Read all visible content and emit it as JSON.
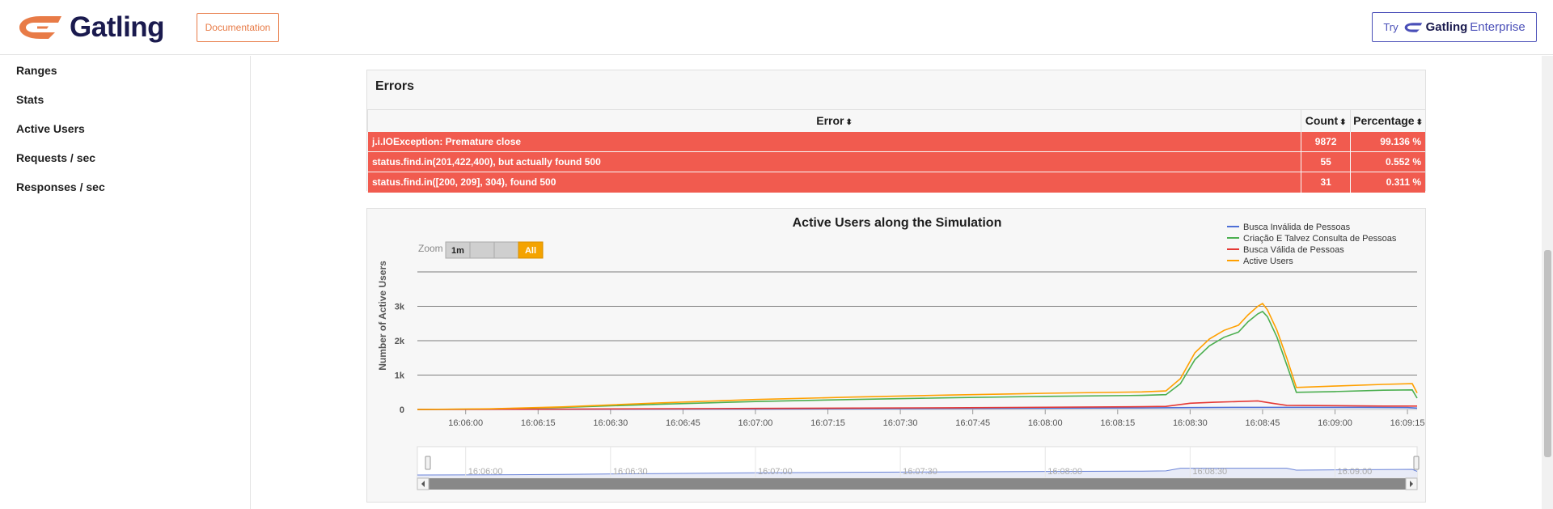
{
  "header": {
    "brand": "Gatling",
    "documentation_label": "Documentation",
    "enterprise_try": "Try",
    "enterprise_brand": "Gatling",
    "enterprise_suffix": "Enterprise"
  },
  "sidebar": {
    "items": [
      {
        "label": "Ranges"
      },
      {
        "label": "Stats"
      },
      {
        "label": "Active Users"
      },
      {
        "label": "Requests / sec"
      },
      {
        "label": "Responses / sec"
      }
    ]
  },
  "errors": {
    "title": "Errors",
    "columns": [
      "Error",
      "Count",
      "Percentage"
    ],
    "rows": [
      {
        "error": "j.i.IOException: Premature close",
        "count": "9872",
        "percentage": "99.136 %"
      },
      {
        "error": "status.find.in(201,422,400), but actually found 500",
        "count": "55",
        "percentage": "0.552 %"
      },
      {
        "error": "status.find.in([200, 209], 304), found 500",
        "count": "31",
        "percentage": "0.311 %"
      }
    ],
    "row_color": "#f15b4f"
  },
  "chart_data": {
    "type": "line",
    "title": "Active Users along the Simulation",
    "ylabel": "Number of Active Users",
    "xlabel": "",
    "zoom": {
      "label": "Zoom",
      "buttons": [
        "1m",
        "",
        "",
        "All"
      ],
      "active": "All"
    },
    "x_ticks": [
      "16:06:00",
      "16:06:15",
      "16:06:30",
      "16:06:45",
      "16:07:00",
      "16:07:15",
      "16:07:30",
      "16:07:45",
      "16:08:00",
      "16:08:15",
      "16:08:30",
      "16:08:45",
      "16:09:00",
      "16:09:15"
    ],
    "y_ticks": [
      "0",
      "1k",
      "2k",
      "3k"
    ],
    "ylim": [
      0,
      4000
    ],
    "x_range_seconds": [
      -10,
      197
    ],
    "navigator_ticks": [
      "16:06:00",
      "16:06:30",
      "16:07:00",
      "16:07:30",
      "16:08:00",
      "16:08:30",
      "16:09:00"
    ],
    "legend_position": "top-right",
    "series": [
      {
        "name": "Busca Inválida de Pessoas",
        "color": "#4e6fd6",
        "points": [
          [
            -10,
            0
          ],
          [
            20,
            5
          ],
          [
            60,
            15
          ],
          [
            100,
            30
          ],
          [
            140,
            45
          ],
          [
            150,
            55
          ],
          [
            160,
            60
          ],
          [
            170,
            60
          ],
          [
            185,
            60
          ],
          [
            195,
            55
          ],
          [
            197,
            40
          ]
        ]
      },
      {
        "name": "Criação E Talvez Consulta de Pessoas",
        "color": "#4caf50",
        "points": [
          [
            -10,
            0
          ],
          [
            5,
            15
          ],
          [
            20,
            60
          ],
          [
            40,
            150
          ],
          [
            60,
            230
          ],
          [
            80,
            290
          ],
          [
            100,
            340
          ],
          [
            120,
            380
          ],
          [
            140,
            410
          ],
          [
            145,
            430
          ],
          [
            148,
            750
          ],
          [
            151,
            1450
          ],
          [
            154,
            1850
          ],
          [
            157,
            2100
          ],
          [
            160,
            2250
          ],
          [
            162,
            2550
          ],
          [
            164,
            2780
          ],
          [
            165,
            2850
          ],
          [
            166,
            2700
          ],
          [
            168,
            2100
          ],
          [
            170,
            1300
          ],
          [
            172,
            500
          ],
          [
            180,
            520
          ],
          [
            190,
            560
          ],
          [
            196,
            570
          ],
          [
            197,
            330
          ]
        ]
      },
      {
        "name": "Busca Válida de Pessoas",
        "color": "#e53935",
        "points": [
          [
            -10,
            0
          ],
          [
            20,
            10
          ],
          [
            60,
            30
          ],
          [
            100,
            50
          ],
          [
            140,
            80
          ],
          [
            145,
            90
          ],
          [
            150,
            180
          ],
          [
            155,
            210
          ],
          [
            160,
            230
          ],
          [
            164,
            250
          ],
          [
            167,
            180
          ],
          [
            170,
            120
          ],
          [
            180,
            110
          ],
          [
            190,
            100
          ],
          [
            197,
            100
          ]
        ]
      },
      {
        "name": "Active Users",
        "color": "#ffa000",
        "points": [
          [
            -10,
            0
          ],
          [
            5,
            20
          ],
          [
            20,
            75
          ],
          [
            40,
            190
          ],
          [
            60,
            290
          ],
          [
            80,
            360
          ],
          [
            100,
            420
          ],
          [
            120,
            470
          ],
          [
            140,
            510
          ],
          [
            145,
            540
          ],
          [
            148,
            900
          ],
          [
            151,
            1650
          ],
          [
            154,
            2050
          ],
          [
            157,
            2300
          ],
          [
            160,
            2450
          ],
          [
            162,
            2750
          ],
          [
            164,
            3000
          ],
          [
            165,
            3080
          ],
          [
            166,
            2900
          ],
          [
            168,
            2300
          ],
          [
            170,
            1500
          ],
          [
            172,
            640
          ],
          [
            180,
            680
          ],
          [
            190,
            730
          ],
          [
            196,
            750
          ],
          [
            197,
            480
          ]
        ]
      }
    ]
  }
}
